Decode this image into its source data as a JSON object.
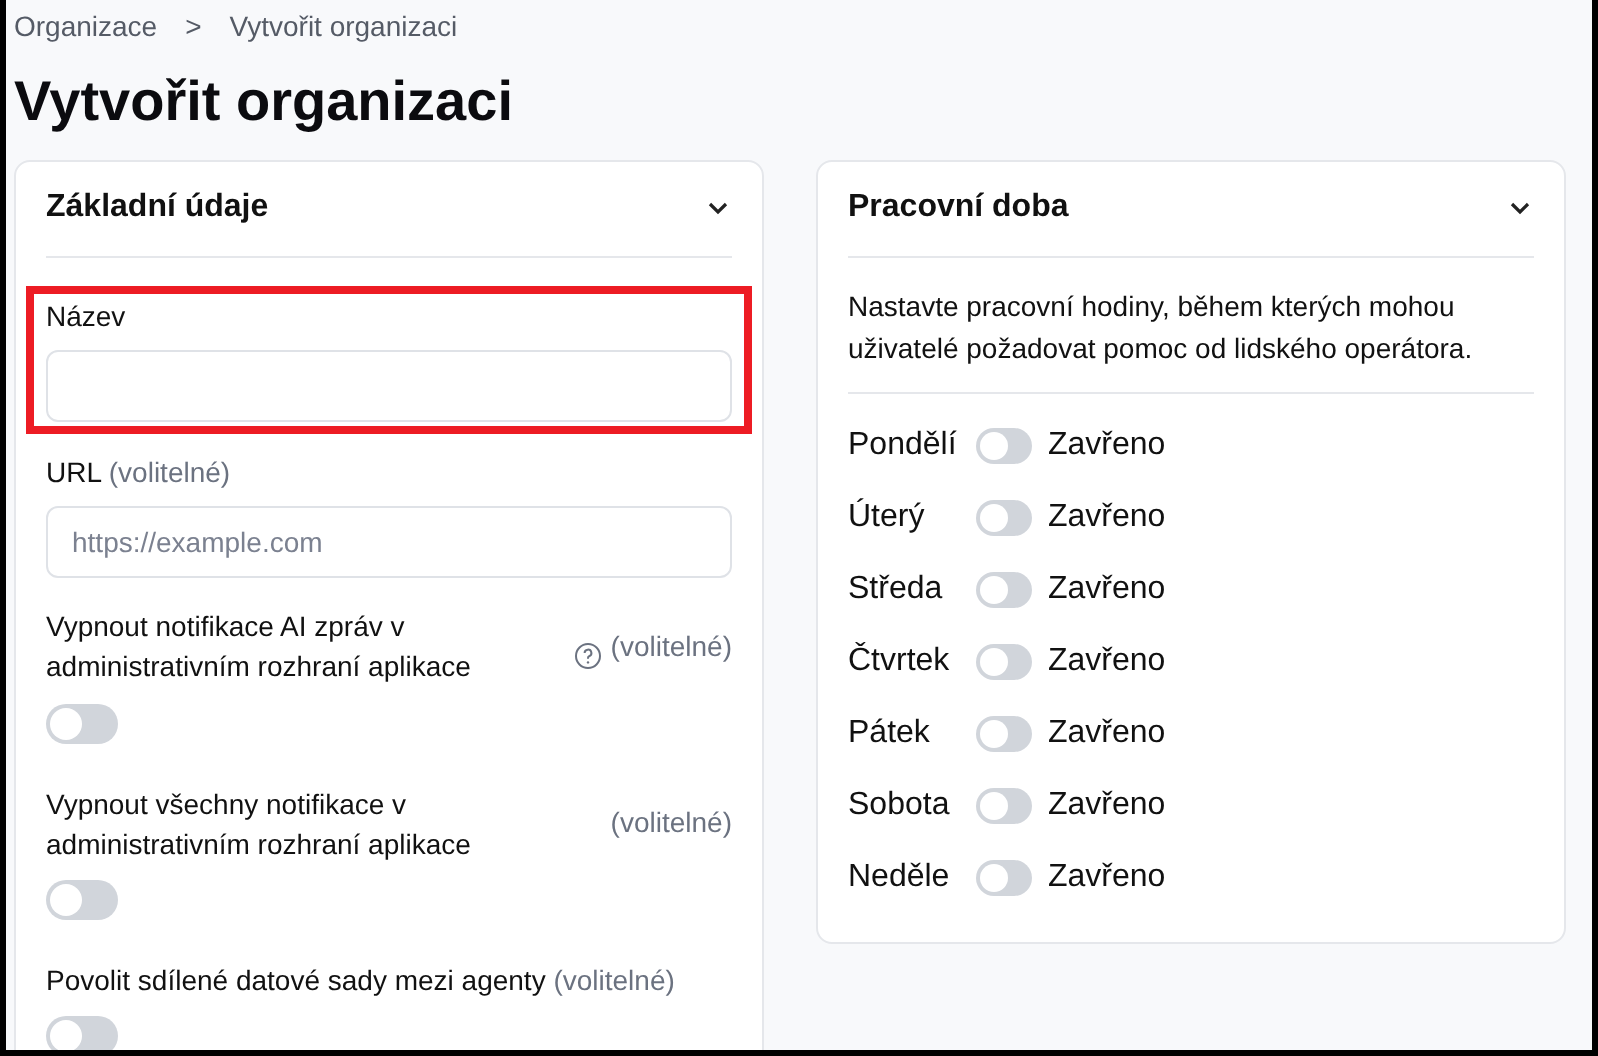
{
  "breadcrumb": [
    {
      "label": "Organizace"
    },
    {
      "label": "Vytvořit organizaci"
    }
  ],
  "breadcrumb_separator": ">",
  "title": "Vytvořit organizaci",
  "basic_info": {
    "title": "Základní údaje",
    "expanded": true,
    "fields": [
      {
        "kind": "text",
        "label": "Název",
        "highlighted": true
      },
      {
        "kind": "text",
        "label": "URL",
        "optional": "(volitelné)",
        "placeholder": "https://example.com"
      },
      {
        "kind": "toggle",
        "label": "Vypnout notifikace AI zpráv v administrativním rozhraní aplikace",
        "help": true,
        "optional": "(volitelné)",
        "checked": false
      },
      {
        "kind": "toggle",
        "label": "Vypnout všechny notifikace v administrativním rozhraní aplikace",
        "optional": "(volitelné)",
        "checked": false
      },
      {
        "kind": "inlinetoggle",
        "label": "Povolit sdílené datové sady mezi agenty",
        "optional": "(volitelné)",
        "checked": false
      }
    ]
  },
  "working_hours": {
    "title": "Pracovní doba",
    "expanded": true,
    "description": "Nastavte pracovní hodiny, během kterých mohou uživatelé požadovat pomoc od lidského operátora.",
    "days": [
      {
        "day": "Pondělí",
        "open": false,
        "status": "Zavřeno"
      },
      {
        "day": "Úterý",
        "open": false,
        "status": "Zavřeno"
      },
      {
        "day": "Středa",
        "open": false,
        "status": "Zavřeno"
      },
      {
        "day": "Čtvrtek",
        "open": false,
        "status": "Zavřeno"
      },
      {
        "day": "Pátek",
        "open": false,
        "status": "Zavřeno"
      },
      {
        "day": "Sobota",
        "open": false,
        "status": "Zavřeno"
      },
      {
        "day": "Neděle",
        "open": false,
        "status": "Zavřeno"
      }
    ]
  }
}
